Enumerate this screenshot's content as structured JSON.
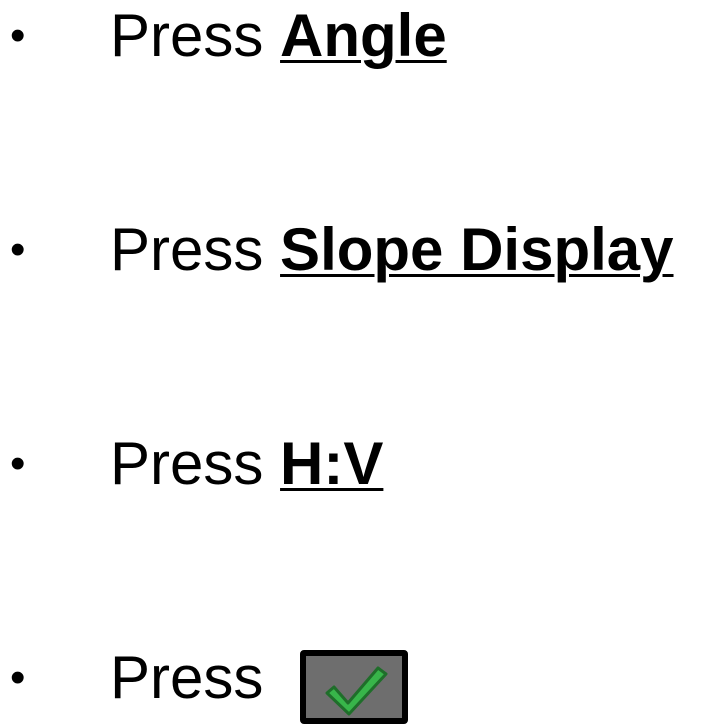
{
  "bullet": "•",
  "steps": [
    {
      "verb": "Press",
      "target": "Angle"
    },
    {
      "verb": "Press",
      "target": "Slope Display"
    },
    {
      "verb": "Press",
      "target": "H:V"
    },
    {
      "verb": "Press",
      "target_icon": "check-icon"
    }
  ],
  "colors": {
    "check_fill": "#38b54a",
    "button_fill": "#6e6e6e",
    "button_border": "#000000"
  }
}
